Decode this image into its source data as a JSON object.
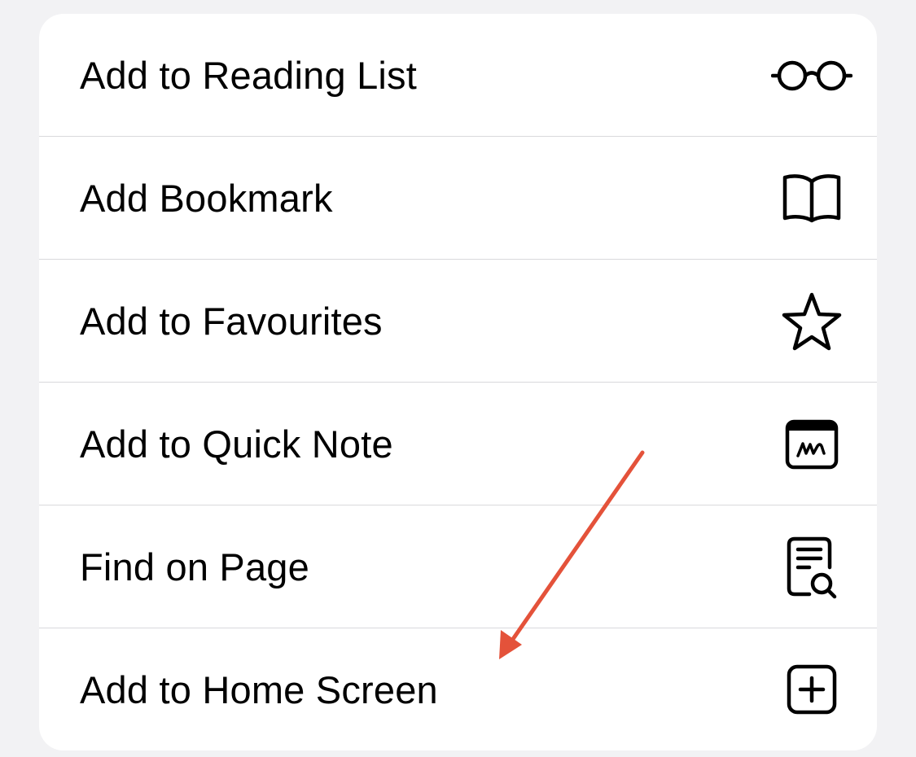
{
  "menu": {
    "items": [
      {
        "label": "Add to Reading List",
        "icon": "glasses-icon"
      },
      {
        "label": "Add Bookmark",
        "icon": "book-icon"
      },
      {
        "label": "Add to Favourites",
        "icon": "star-icon"
      },
      {
        "label": "Add to Quick Note",
        "icon": "quick-note-icon"
      },
      {
        "label": "Find on Page",
        "icon": "find-on-page-icon"
      },
      {
        "label": "Add to Home Screen",
        "icon": "plus-square-icon"
      }
    ]
  },
  "colors": {
    "background": "#f2f2f4",
    "card": "#ffffff",
    "divider": "#d9d9dc",
    "text": "#000000",
    "annotation_arrow": "#e4523a"
  },
  "annotation": {
    "type": "arrow",
    "points_to": "Add to Home Screen"
  }
}
